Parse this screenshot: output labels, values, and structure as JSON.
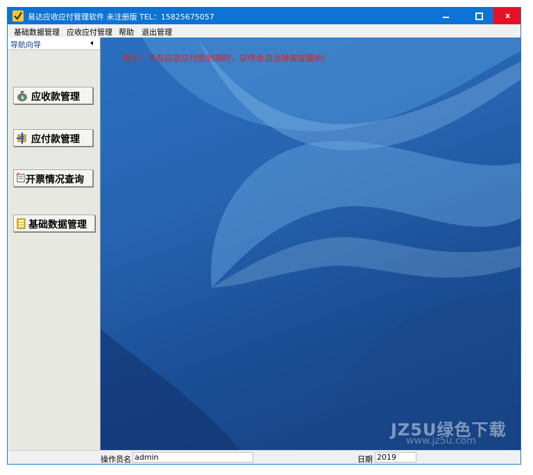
{
  "window": {
    "title": "易达应收应付管理软件 未注册版  TEL：15825675057",
    "controls": {
      "minimize_icon": "minimize-icon",
      "maximize_icon": "maximize-icon",
      "close_label": "x"
    }
  },
  "menu": {
    "items": [
      {
        "label": "基础数据管理"
      },
      {
        "label": "应收应付管理"
      },
      {
        "label": "帮助"
      },
      {
        "label": "退出管理"
      }
    ]
  },
  "sidebar": {
    "header": "导航向导",
    "buttons": [
      {
        "label": "应收款管理",
        "icon": "money-bag-icon"
      },
      {
        "label": "应付款管理",
        "icon": "payment-icon"
      },
      {
        "label": "开票情况查询",
        "icon": "invoice-icon"
      },
      {
        "label": "基础数据管理",
        "icon": "database-icon"
      }
    ]
  },
  "content": {
    "notice": "提示：当有应收应付款到期时，软件会自动弹窗提醒的!",
    "watermark": "JZ5U绿色下载",
    "watermark_sub": "www.jz5u.com"
  },
  "status": {
    "operator_label": "操作员名",
    "operator_value": "admin",
    "date_label": "日期",
    "date_value": "2019"
  },
  "colors": {
    "titlebar": "#0d73d4",
    "close_button": "#e81123",
    "notice_text": "#e02020",
    "sidebar_header_text": "#0b3b97"
  }
}
